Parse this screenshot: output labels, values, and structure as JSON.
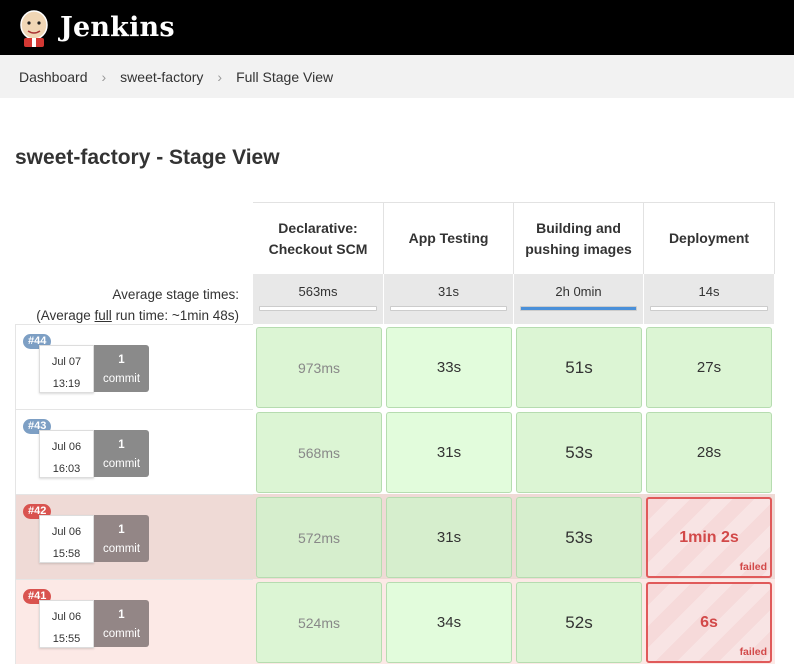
{
  "header": {
    "brand": "Jenkins"
  },
  "breadcrumb": [
    "Dashboard",
    "sweet-factory",
    "Full Stage View"
  ],
  "page_title": "sweet-factory - Stage View",
  "stages": [
    "Declarative: Checkout SCM",
    "App Testing",
    "Building and pushing images",
    "Deployment"
  ],
  "stage_heads": {
    "s0_line1": "Declarative:",
    "s0_line2": "Checkout SCM",
    "s1": "App Testing",
    "s2_line1": "Building and",
    "s2_line2": "pushing images",
    "s3": "Deployment"
  },
  "average": {
    "line1": "Average stage times:",
    "line2_prefix": "(Average ",
    "line2_link": "full",
    "line2_suffix": " run time: ~1min 48s)",
    "times": [
      "563ms",
      "31s",
      "2h 0min",
      "14s"
    ],
    "bar_fill_fraction": [
      0,
      0,
      1,
      0
    ]
  },
  "runs": [
    {
      "id": "#44",
      "date": "Jul 07",
      "time": "13:19",
      "commits": "1",
      "commit_label": "commit",
      "status": "success",
      "durations": [
        "973ms",
        "33s",
        "51s",
        "27s"
      ]
    },
    {
      "id": "#43",
      "date": "Jul 06",
      "time": "16:03",
      "commits": "1",
      "commit_label": "commit",
      "status": "success",
      "durations": [
        "568ms",
        "31s",
        "53s",
        "28s"
      ]
    },
    {
      "id": "#42",
      "date": "Jul 06",
      "time": "15:58",
      "commits": "1",
      "commit_label": "commit",
      "status": "failed",
      "durations": [
        "572ms",
        "31s",
        "53s",
        "1min 2s"
      ],
      "failed_label": "failed"
    },
    {
      "id": "#41",
      "date": "Jul 06",
      "time": "15:55",
      "commits": "1",
      "commit_label": "commit",
      "status": "failed",
      "durations": [
        "524ms",
        "34s",
        "52s",
        "6s"
      ],
      "failed_label": "failed"
    }
  ],
  "colors": {
    "badge_success": "#7d9fc4",
    "badge_failed": "#d9534f",
    "commit_success": "#8a8a8a",
    "commit_failed": "#938686"
  }
}
